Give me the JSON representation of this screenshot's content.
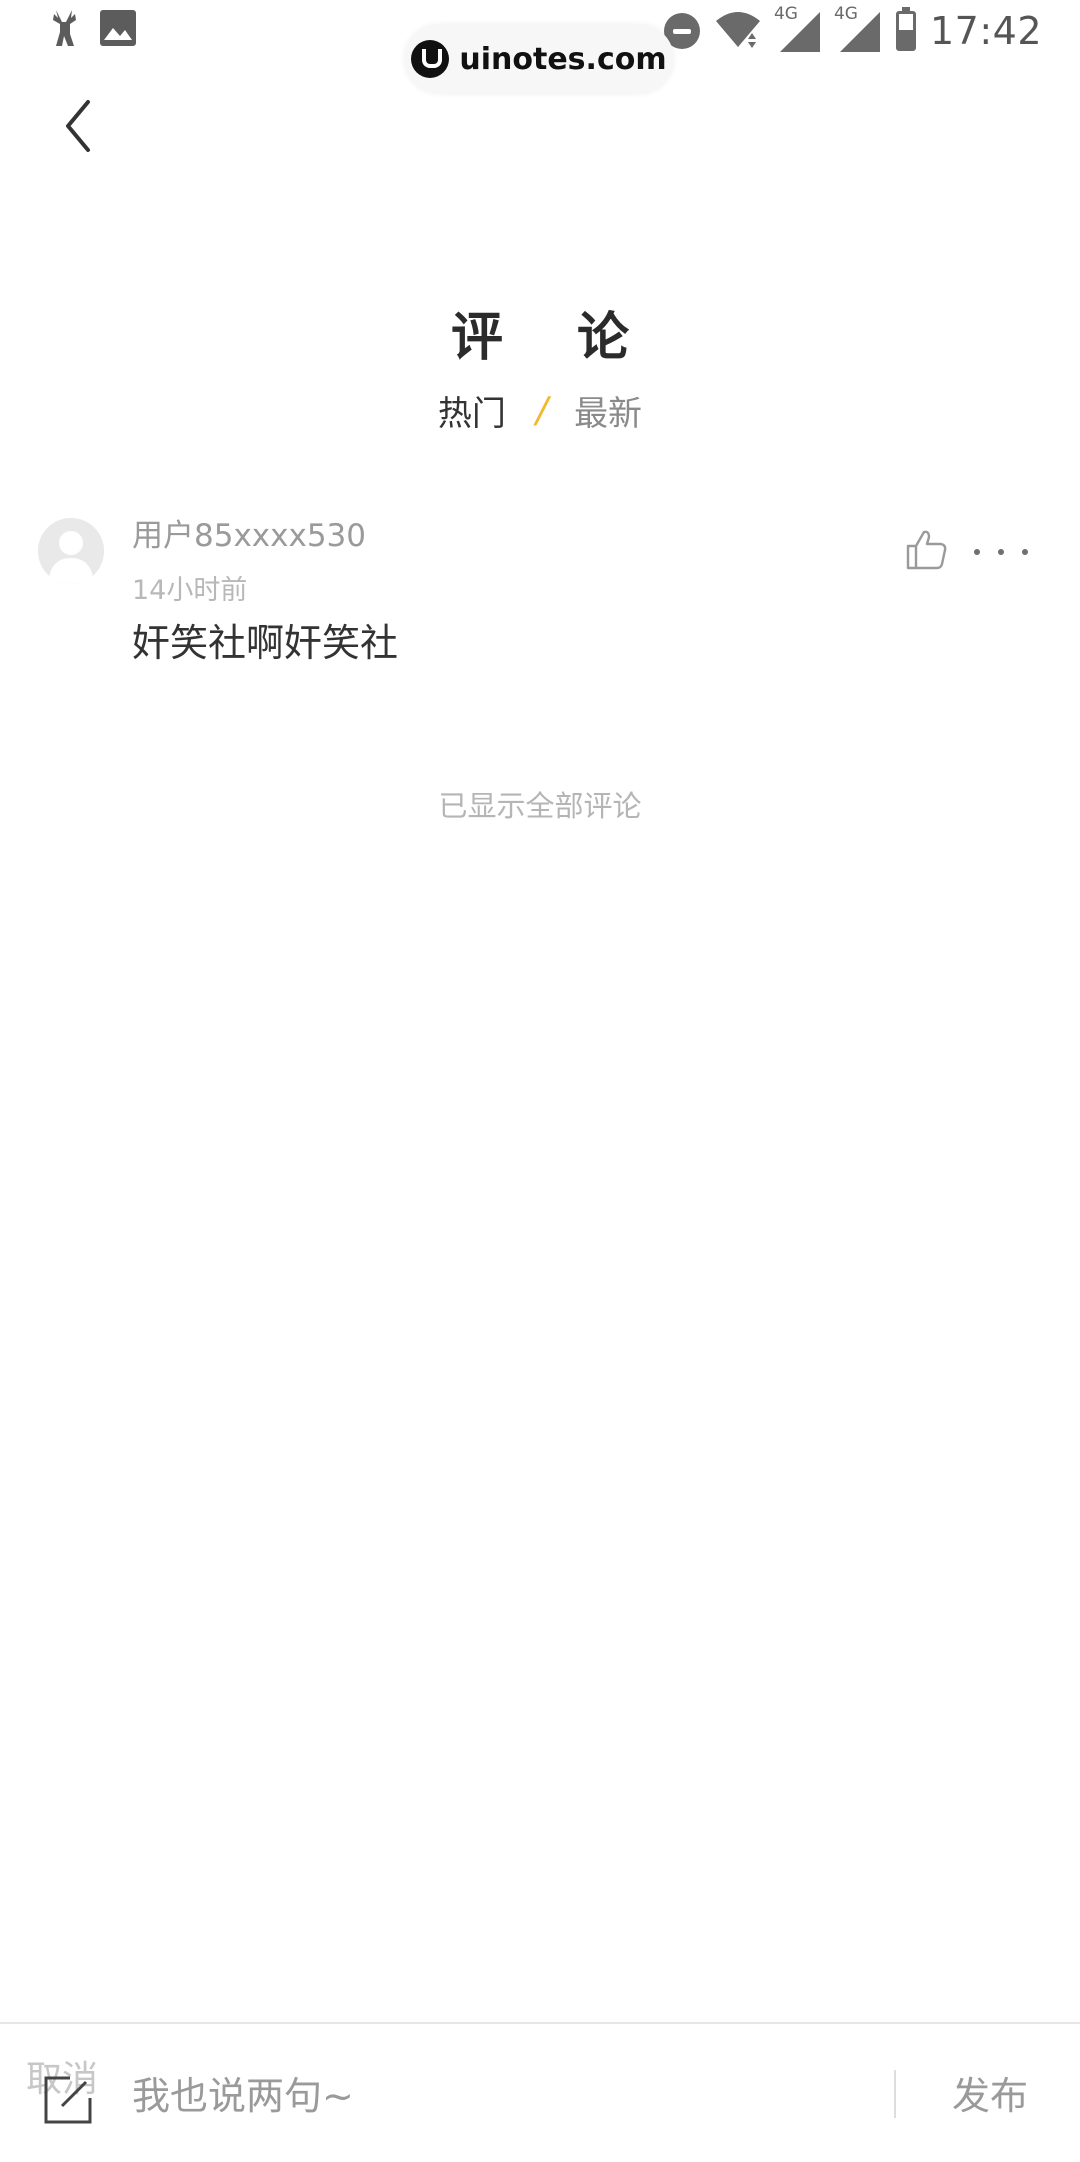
{
  "status_bar": {
    "time": "17:42",
    "network_1": "4G",
    "network_2": "4G",
    "left_icons": [
      "deer-app-icon",
      "image-icon"
    ],
    "right_icons": [
      "do-not-disturb-icon",
      "wifi-icon",
      "signal-icon",
      "signal-icon",
      "battery-icon"
    ]
  },
  "watermark": {
    "text": "uinotes.com"
  },
  "header": {
    "title": "评 论",
    "tabs": [
      {
        "label": "热门",
        "active": true
      },
      {
        "label": "最新",
        "active": false
      }
    ],
    "tab_divider": "/",
    "accent_color": "#f2b830"
  },
  "comments": [
    {
      "user": "用户85xxxx530",
      "time": "14小时前",
      "text": "奸笑社啊奸笑社"
    }
  ],
  "footer_note": "已显示全部评论",
  "input_bar": {
    "cancel_label": "取消",
    "placeholder": "我也说两句~",
    "publish_label": "发布"
  }
}
